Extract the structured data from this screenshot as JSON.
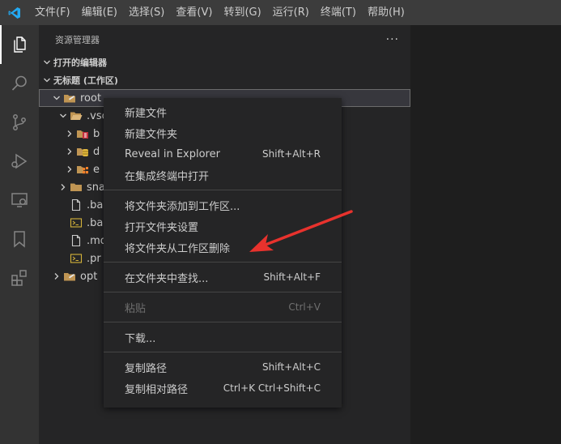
{
  "menubar": {
    "items": [
      "文件(F)",
      "编辑(E)",
      "选择(S)",
      "查看(V)",
      "转到(G)",
      "运行(R)",
      "终端(T)",
      "帮助(H)"
    ]
  },
  "activity_bar": {
    "icons": [
      "files-icon",
      "search-icon",
      "source-control-icon",
      "run-debug-icon",
      "remote-explorer-icon",
      "bookmark-icon",
      "extensions-icon"
    ]
  },
  "sidebar": {
    "title": "资源管理器",
    "more": "···",
    "open_editors": "打开的编辑器",
    "workspace": "无标题 (工作区)",
    "tree": [
      {
        "label": "root",
        "kind": "root-folder",
        "indent": 0,
        "expanded": true
      },
      {
        "label": ".vsc",
        "kind": "folder-open",
        "indent": 1,
        "expanded": true
      },
      {
        "label": "b",
        "kind": "box-red",
        "indent": 2,
        "expanded": false
      },
      {
        "label": "d",
        "kind": "db-yellow",
        "indent": 2,
        "expanded": false
      },
      {
        "label": "e",
        "kind": "ext-orange",
        "indent": 2,
        "expanded": false
      },
      {
        "label": "sna",
        "kind": "folder",
        "indent": 1,
        "expanded": false
      },
      {
        "label": ".ba",
        "kind": "file",
        "indent": 1
      },
      {
        "label": ".ba",
        "kind": "terminal-file",
        "indent": 1
      },
      {
        "label": ".mo",
        "kind": "file",
        "indent": 1
      },
      {
        "label": ".pr",
        "kind": "terminal-file",
        "indent": 1
      },
      {
        "label": "opt",
        "kind": "root-folder",
        "indent": 0,
        "expanded": false
      }
    ]
  },
  "context_menu": {
    "groups": [
      [
        {
          "label": "新建文件",
          "shortcut": ""
        },
        {
          "label": "新建文件夹",
          "shortcut": ""
        },
        {
          "label": "Reveal in Explorer",
          "shortcut": "Shift+Alt+R"
        },
        {
          "label": "在集成终端中打开",
          "shortcut": ""
        }
      ],
      [
        {
          "label": "将文件夹添加到工作区...",
          "shortcut": ""
        },
        {
          "label": "打开文件夹设置",
          "shortcut": ""
        },
        {
          "label": "将文件夹从工作区删除",
          "shortcut": ""
        }
      ],
      [
        {
          "label": "在文件夹中查找...",
          "shortcut": "Shift+Alt+F"
        }
      ],
      [
        {
          "label": "粘贴",
          "shortcut": "Ctrl+V",
          "disabled": true
        }
      ],
      [
        {
          "label": "下载...",
          "shortcut": ""
        }
      ],
      [
        {
          "label": "复制路径",
          "shortcut": "Shift+Alt+C"
        },
        {
          "label": "复制相对路径",
          "shortcut": "Ctrl+K Ctrl+Shift+C"
        }
      ]
    ]
  },
  "colors": {
    "accent": "#007acc",
    "annotation_arrow": "#e8322d"
  }
}
